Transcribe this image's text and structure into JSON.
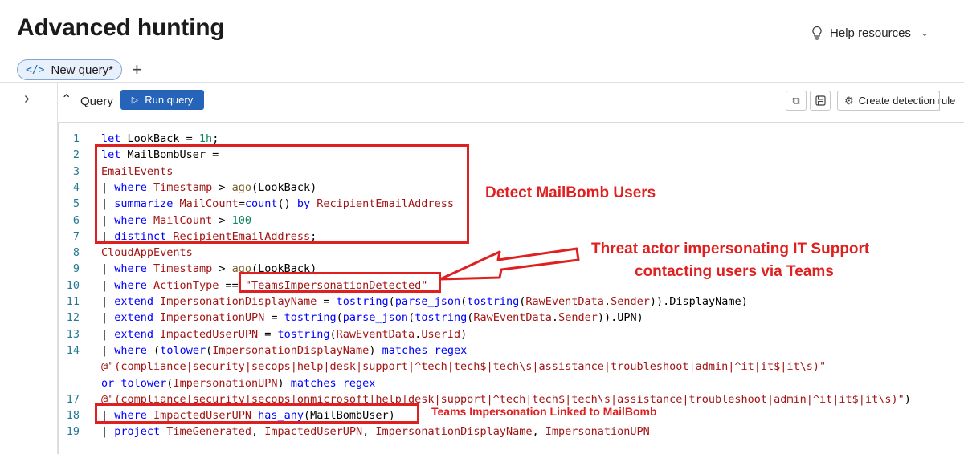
{
  "page": {
    "title": "Advanced hunting"
  },
  "help": {
    "label": "Help resources",
    "icon": "lightbulb-icon"
  },
  "tabs": [
    {
      "label": "New query*",
      "icon": "code-icon"
    }
  ],
  "query_bar": {
    "label": "Query",
    "run_label": "Run query",
    "create_detection_label": "Create detection rule"
  },
  "editor": {
    "lines": [
      {
        "n": "1",
        "tokens": [
          [
            "kw",
            "let "
          ],
          [
            "pl",
            "LookBack = "
          ],
          [
            "num",
            "1h"
          ],
          [
            "pl",
            ";"
          ]
        ]
      },
      {
        "n": "2",
        "tokens": [
          [
            "kw",
            "let "
          ],
          [
            "pl",
            "MailBombUser ="
          ]
        ]
      },
      {
        "n": "3",
        "tokens": [
          [
            "tb",
            "EmailEvents"
          ]
        ]
      },
      {
        "n": "4",
        "tokens": [
          [
            "pipe",
            "| "
          ],
          [
            "kw",
            "where "
          ],
          [
            "col",
            "Timestamp"
          ],
          [
            "pl",
            " > "
          ],
          [
            "fn",
            "ago"
          ],
          [
            "pl",
            "(LookBack)"
          ]
        ]
      },
      {
        "n": "5",
        "tokens": [
          [
            "pipe",
            "| "
          ],
          [
            "kw",
            "summarize "
          ],
          [
            "col",
            "MailCount"
          ],
          [
            "pl",
            "="
          ],
          [
            "kw",
            "count"
          ],
          [
            "pl",
            "() "
          ],
          [
            "kw",
            "by "
          ],
          [
            "col",
            "RecipientEmailAddress"
          ]
        ]
      },
      {
        "n": "6",
        "tokens": [
          [
            "pipe",
            "| "
          ],
          [
            "kw",
            "where "
          ],
          [
            "col",
            "MailCount"
          ],
          [
            "pl",
            " > "
          ],
          [
            "num",
            "100"
          ]
        ]
      },
      {
        "n": "7",
        "tokens": [
          [
            "pipe",
            "| "
          ],
          [
            "kw",
            "distinct "
          ],
          [
            "col",
            "RecipientEmailAddress"
          ],
          [
            "pl",
            ";"
          ]
        ]
      },
      {
        "n": "8",
        "tokens": [
          [
            "tb",
            "CloudAppEvents"
          ]
        ]
      },
      {
        "n": "9",
        "tokens": [
          [
            "pipe",
            "| "
          ],
          [
            "kw",
            "where "
          ],
          [
            "col",
            "Timestamp"
          ],
          [
            "pl",
            " > "
          ],
          [
            "fn",
            "ago"
          ],
          [
            "pl",
            "(LookBack)"
          ]
        ]
      },
      {
        "n": "10",
        "tokens": [
          [
            "pipe",
            "| "
          ],
          [
            "kw",
            "where "
          ],
          [
            "col",
            "ActionType"
          ],
          [
            "pl",
            " == "
          ],
          [
            "str",
            "\"TeamsImpersonationDetected\""
          ]
        ]
      },
      {
        "n": "11",
        "tokens": [
          [
            "pipe",
            "| "
          ],
          [
            "kw",
            "extend "
          ],
          [
            "col",
            "ImpersonationDisplayName"
          ],
          [
            "pl",
            " = "
          ],
          [
            "kw",
            "tostring"
          ],
          [
            "pl",
            "("
          ],
          [
            "kw",
            "parse_json"
          ],
          [
            "pl",
            "("
          ],
          [
            "kw",
            "tostring"
          ],
          [
            "pl",
            "("
          ],
          [
            "col",
            "RawEventData"
          ],
          [
            "pl",
            "."
          ],
          [
            "col",
            "Sender"
          ],
          [
            "pl",
            ")).DisplayName)"
          ]
        ]
      },
      {
        "n": "12",
        "tokens": [
          [
            "pipe",
            "| "
          ],
          [
            "kw",
            "extend "
          ],
          [
            "col",
            "ImpersonationUPN"
          ],
          [
            "pl",
            " = "
          ],
          [
            "kw",
            "tostring"
          ],
          [
            "pl",
            "("
          ],
          [
            "kw",
            "parse_json"
          ],
          [
            "pl",
            "("
          ],
          [
            "kw",
            "tostring"
          ],
          [
            "pl",
            "("
          ],
          [
            "col",
            "RawEventData"
          ],
          [
            "pl",
            "."
          ],
          [
            "col",
            "Sender"
          ],
          [
            "pl",
            ")).UPN)"
          ]
        ]
      },
      {
        "n": "13",
        "tokens": [
          [
            "pipe",
            "| "
          ],
          [
            "kw",
            "extend "
          ],
          [
            "col",
            "ImpactedUserUPN"
          ],
          [
            "pl",
            " = "
          ],
          [
            "kw",
            "tostring"
          ],
          [
            "pl",
            "("
          ],
          [
            "col",
            "RawEventData"
          ],
          [
            "pl",
            "."
          ],
          [
            "col",
            "UserId"
          ],
          [
            "pl",
            ")"
          ]
        ]
      },
      {
        "n": "14",
        "tokens": [
          [
            "pipe",
            "| "
          ],
          [
            "kw",
            "where "
          ],
          [
            "pl",
            "("
          ],
          [
            "kw",
            "tolower"
          ],
          [
            "pl",
            "("
          ],
          [
            "col",
            "ImpersonationDisplayName"
          ],
          [
            "pl",
            ") "
          ],
          [
            "kw",
            "matches regex"
          ]
        ]
      },
      {
        "n": "",
        "tokens": [
          [
            "str",
            "@\"(compliance|security|secops|help|desk|support|^tech|tech$|tech\\s|assistance|troubleshoot|admin|^it|it$|it\\s)\""
          ]
        ]
      },
      {
        "n": "",
        "tokens": [
          [
            "kw",
            "or "
          ],
          [
            "kw",
            "tolower"
          ],
          [
            "pl",
            "("
          ],
          [
            "col",
            "ImpersonationUPN"
          ],
          [
            "pl",
            ") "
          ],
          [
            "kw",
            "matches regex"
          ]
        ]
      },
      {
        "n": "17",
        "tokens": [
          [
            "str",
            "@\"(compliance|security|secops|onmicrosoft|help|desk|support|^tech|tech$|tech\\s|assistance|troubleshoot|admin|^it|it$|it\\s)\""
          ],
          [
            "pl",
            ")"
          ]
        ]
      },
      {
        "n": "18",
        "tokens": [
          [
            "pipe",
            "| "
          ],
          [
            "kw",
            "where "
          ],
          [
            "col",
            "ImpactedUserUPN"
          ],
          [
            "pl",
            " "
          ],
          [
            "kw",
            "has_any"
          ],
          [
            "pl",
            "(MailBombUser)"
          ]
        ]
      },
      {
        "n": "19",
        "tokens": [
          [
            "pipe",
            "| "
          ],
          [
            "kw",
            "project "
          ],
          [
            "col",
            "TimeGenerated"
          ],
          [
            "pl",
            ", "
          ],
          [
            "col",
            "ImpactedUserUPN"
          ],
          [
            "pl",
            ", "
          ],
          [
            "col",
            "ImpersonationDisplayName"
          ],
          [
            "pl",
            ", "
          ],
          [
            "col",
            "ImpersonationUPN"
          ]
        ]
      }
    ]
  },
  "annotations": {
    "mailbomb": "Detect MailBomb Users",
    "threat_line1": "Threat actor impersonating IT Support",
    "threat_line2": "contacting users via Teams",
    "linked": "Teams Impersonation Linked to MailBomb"
  },
  "colors": {
    "annotation_red": "#e02020",
    "run_button": "#2564b8",
    "keyword": "#0000ff"
  }
}
